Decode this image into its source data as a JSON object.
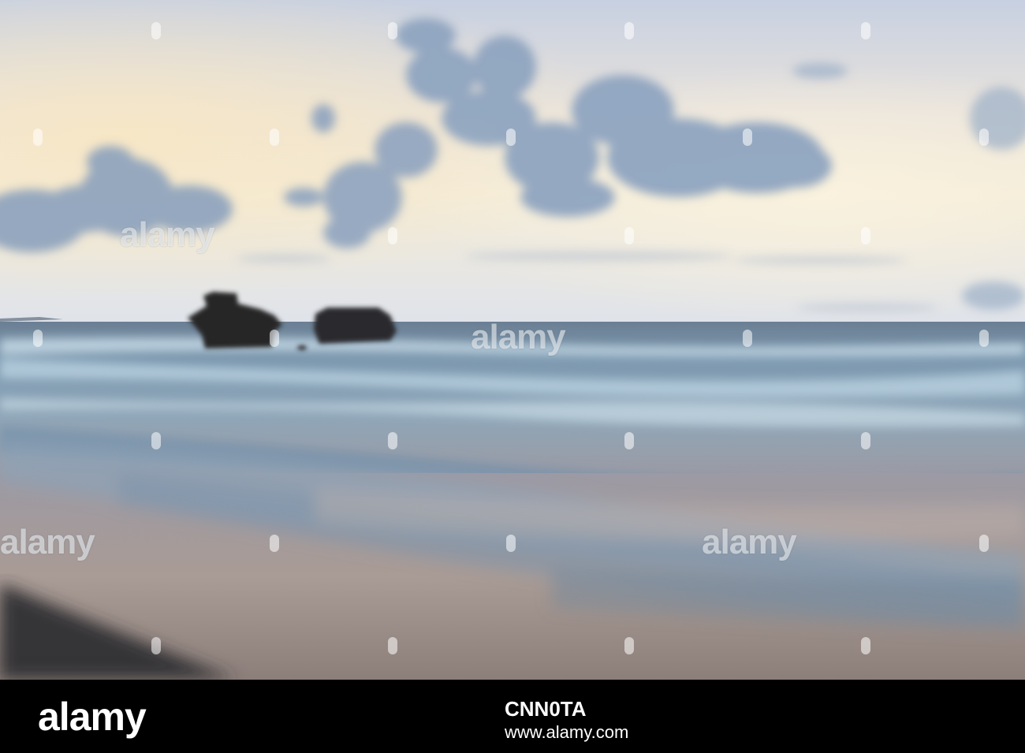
{
  "watermark": {
    "brand": "alamy"
  },
  "footer": {
    "brand": "alamy",
    "image_id": "CNN0TA",
    "url": "www.alamy.com"
  },
  "colors": {
    "sky_top": "#c9d3e3",
    "sky_glow": "#f3ead8",
    "cloud": "#8ea5c2",
    "sea": "#6f8aa3",
    "surf": "#c7dce8",
    "sand": "#a79a92",
    "rock": "#2a2a2c",
    "footer_bg": "#000000"
  }
}
